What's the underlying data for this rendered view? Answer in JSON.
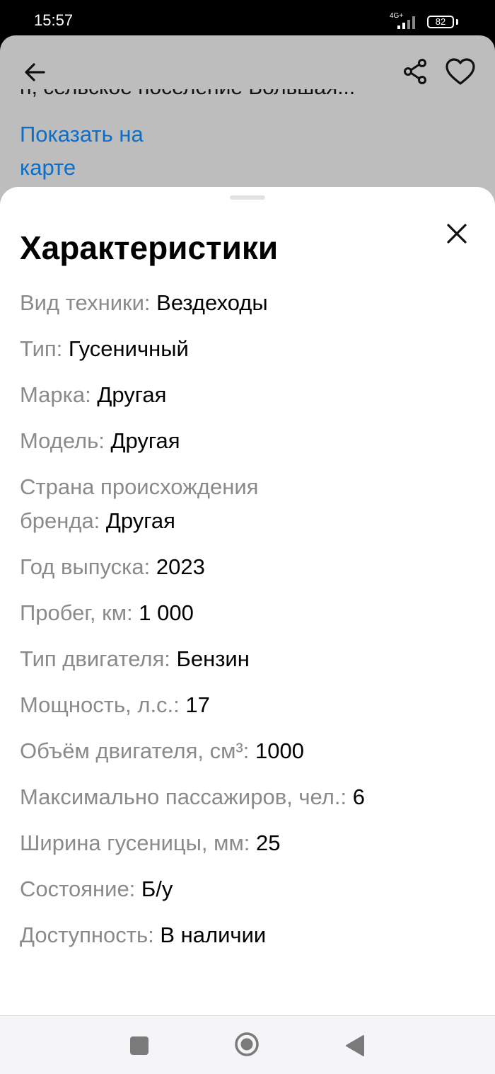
{
  "status_bar": {
    "time": "15:57",
    "network": "4G+",
    "battery": "82"
  },
  "ad_page": {
    "address_fragment": "н, сельское поселение Большая...",
    "show_on_map": "Показать на карте"
  },
  "sheet": {
    "title": "Характеристики",
    "specs": [
      {
        "label": "Вид техники: ",
        "value": "Вездеходы"
      },
      {
        "label": "Тип: ",
        "value": "Гусеничный"
      },
      {
        "label": "Марка: ",
        "value": "Другая"
      },
      {
        "label": "Модель: ",
        "value": "Другая"
      },
      {
        "label": "Страна происхождения бренда: ",
        "value": "Другая"
      },
      {
        "label": "Год выпуска: ",
        "value": "2023"
      },
      {
        "label": "Пробег, км: ",
        "value": "1 000"
      },
      {
        "label": "Тип двигателя: ",
        "value": "Бензин"
      },
      {
        "label": "Мощность, л.с.: ",
        "value": "17"
      },
      {
        "label": "Объём двигателя, см³: ",
        "value": "1000"
      },
      {
        "label": "Максимально пассажиров, чел.: ",
        "value": "6"
      },
      {
        "label": "Ширина гусеницы, мм: ",
        "value": "25"
      },
      {
        "label": "Состояние: ",
        "value": "Б/у"
      },
      {
        "label": "Доступность: ",
        "value": "В наличии"
      }
    ]
  },
  "colors": {
    "link": "#0d6ec9",
    "label_gray": "#8a8a8a",
    "dim_overlay": "#bdbdbd"
  },
  "icons": [
    "arrow-left-icon",
    "share-icon",
    "heart-icon",
    "close-icon",
    "recents-icon",
    "home-icon",
    "back-triangle-icon"
  ]
}
